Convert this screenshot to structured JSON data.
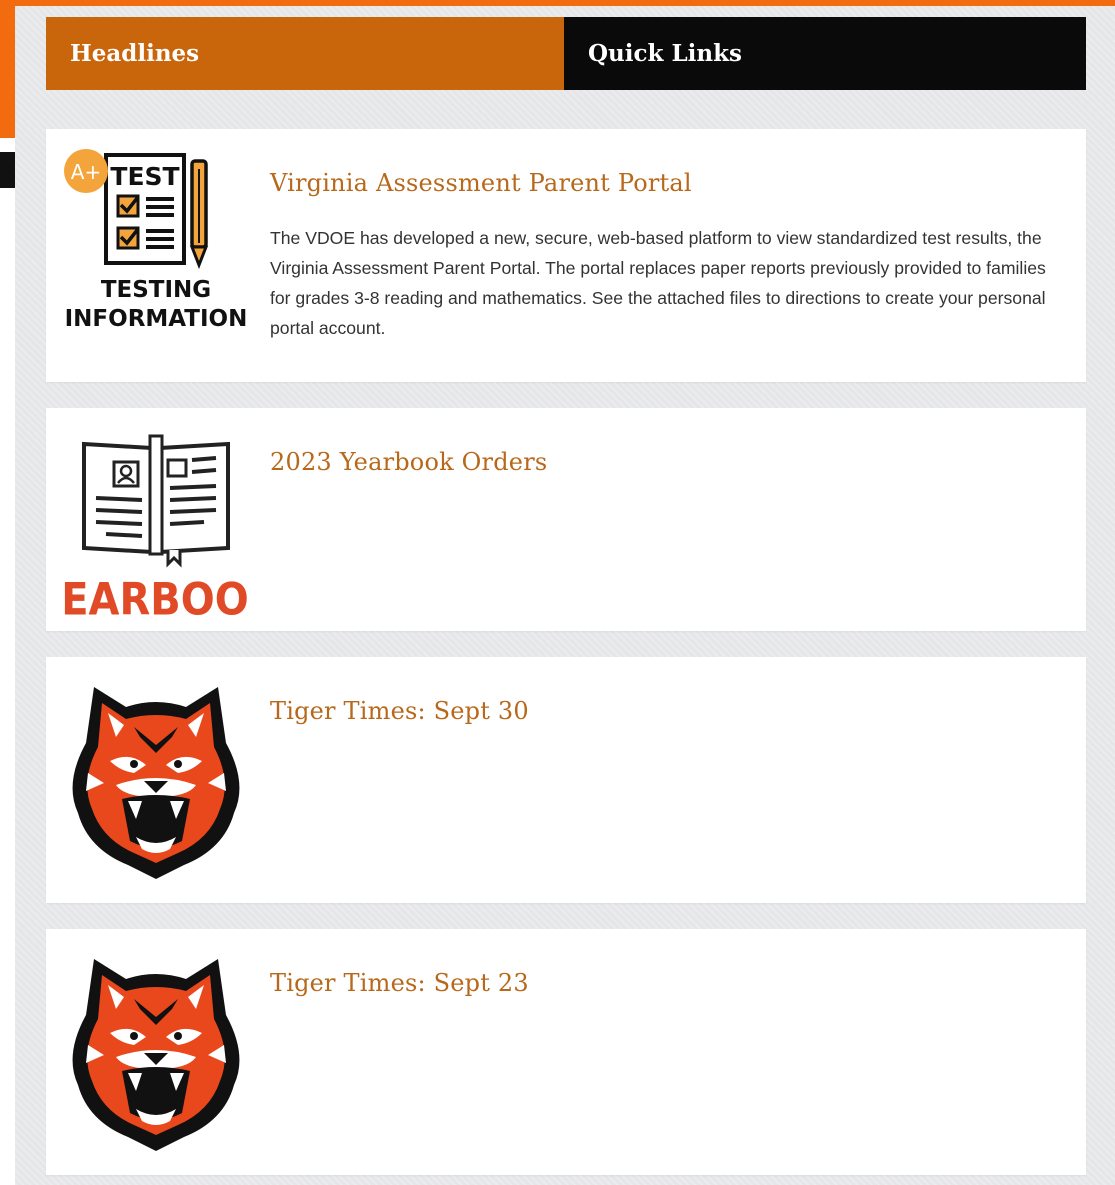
{
  "tabs": {
    "headlines": "Headlines",
    "quick_links": "Quick Links"
  },
  "colors": {
    "accent_orange": "#f26b0f",
    "tab_active": "#c9650a",
    "title_link": "#b8681a",
    "tiger_orange": "#e8481c"
  },
  "articles": [
    {
      "title": "Virginia Assessment Parent Portal",
      "body": "The VDOE has developed a new, secure, web-based platform to view standardized test results, the Virginia Assessment Parent Portal. The portal replaces paper reports previously provided to families for grades 3-8 reading and mathematics. See the attached files to directions to create your personal portal account.",
      "thumbnail_icon": "testing-information-icon",
      "thumbnail_text": {
        "badge": "A+",
        "test": "TEST",
        "line1": "TESTING",
        "line2": "INFORMATION"
      }
    },
    {
      "title": "2023 Yearbook Orders",
      "thumbnail_icon": "yearbook-icon",
      "thumbnail_text": {
        "word": "YEARBOOK"
      }
    },
    {
      "title": "Tiger Times: Sept 30",
      "thumbnail_icon": "tiger-mascot-icon"
    },
    {
      "title": "Tiger Times: Sept 23",
      "thumbnail_icon": "tiger-mascot-icon"
    }
  ]
}
